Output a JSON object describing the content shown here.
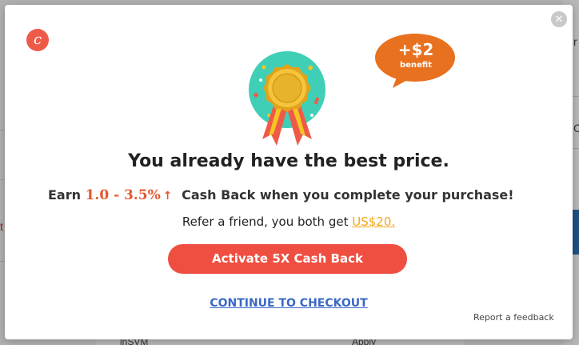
{
  "modal": {
    "logo_letter": "c",
    "close_symbol": "✕",
    "badge": {
      "amount": "+$2",
      "label": "benefit",
      "color": "#e8711f"
    },
    "headline": "You already have the best price.",
    "earn": {
      "prefix": "Earn",
      "rate": "1.0 - 3.5%",
      "arrow": "↑",
      "suffix": "Cash Back when you complete your purchase!"
    },
    "refer": {
      "text": "Refer a friend, you both get",
      "amount": "US$20."
    },
    "activate_button": "Activate 5X Cash Back",
    "checkout_link": "CONTINUE TO CHECKOUT",
    "feedback_link": "Report a feedback",
    "accent_color": "#ef4f41",
    "link_color": "#3a68c6"
  },
  "background": {
    "frag_r": "r",
    "frag_c": "C",
    "frag_t": "t",
    "frag_name": "lnSVM",
    "frag_apply": "Apply"
  }
}
